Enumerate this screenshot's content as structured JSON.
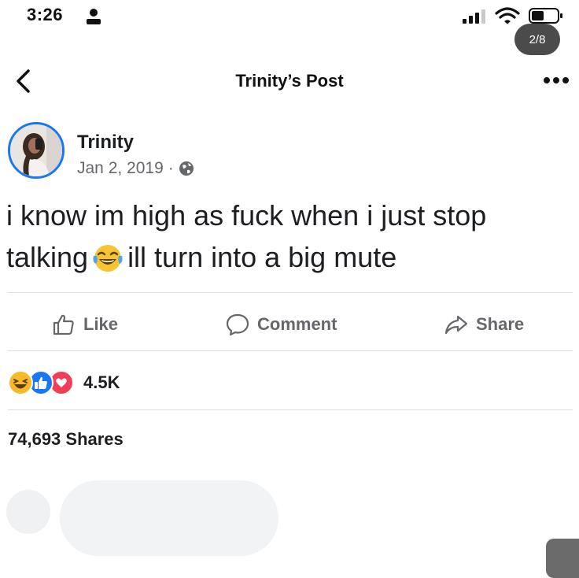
{
  "status_bar": {
    "time": "3:26",
    "page_indicator": "2/8"
  },
  "header": {
    "title": "Trinity’s Post"
  },
  "post": {
    "author": "Trinity",
    "date": "Jan 2, 2019",
    "separator": "·",
    "text_before_emoji": "i know im high as fuck when i just stop talking",
    "emoji": "laughing-tears",
    "text_after_emoji": "ill turn into a big mute"
  },
  "actions": {
    "like_label": "Like",
    "comment_label": "Comment",
    "share_label": "Share"
  },
  "reactions": {
    "types": [
      "haha",
      "like",
      "love"
    ],
    "count": "4.5K"
  },
  "shares_text": "74,693 Shares",
  "colors": {
    "brand_blue": "#1877f2",
    "muted_text": "#65676b",
    "love_red": "#f33e58",
    "haha_yellow": "#f7b928"
  }
}
